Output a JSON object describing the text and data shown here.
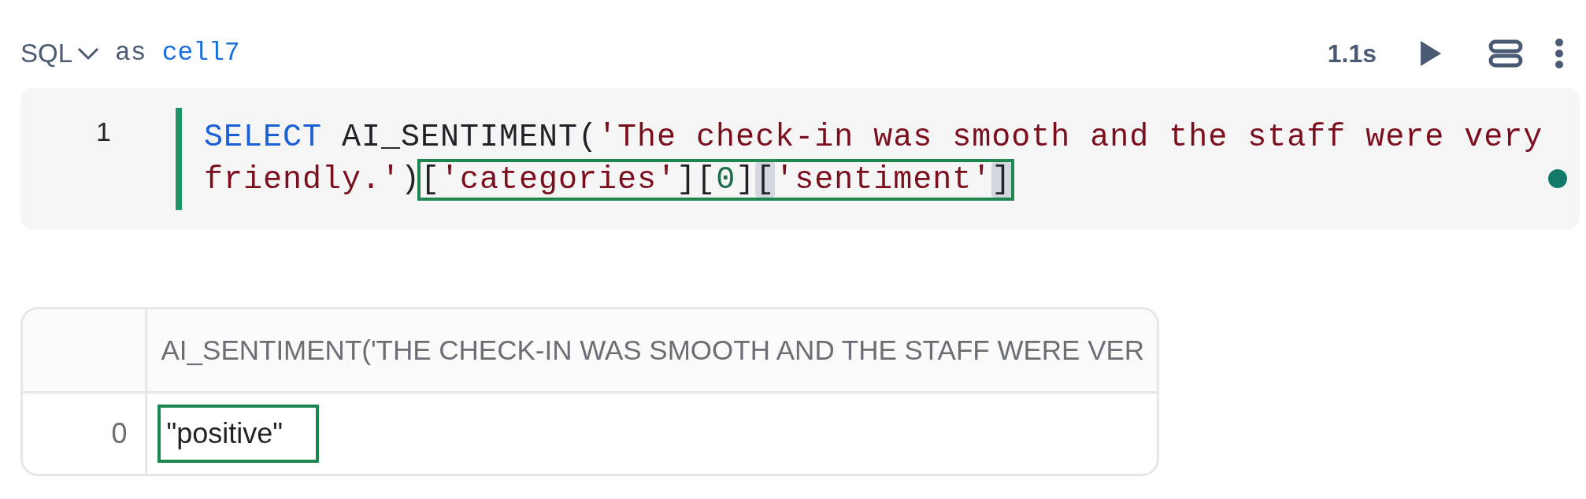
{
  "cell_header": {
    "language": "SQL",
    "as_label": "as",
    "cell_name": "cell7",
    "duration": "1.1s"
  },
  "code": {
    "line_number": "1",
    "rows": [
      [
        {
          "kind": "keyword",
          "text": "SELECT"
        },
        {
          "kind": "plain",
          "text": " AI_SENTIMENT("
        },
        {
          "kind": "string",
          "text": "'The check-in was smooth and the staff were very"
        }
      ],
      [
        {
          "kind": "string",
          "text": "friendly.'"
        },
        {
          "kind": "plain",
          "text": ")"
        },
        {
          "kind": "callout",
          "tokens": [
            {
              "kind": "plain",
              "text": "["
            },
            {
              "kind": "string",
              "text": "'categories'"
            },
            {
              "kind": "plain",
              "text": "]["
            },
            {
              "kind": "number",
              "text": "0"
            },
            {
              "kind": "plain",
              "text": "]"
            },
            {
              "kind": "bracket_match",
              "text": "["
            },
            {
              "kind": "string",
              "text": "'sentiment'"
            },
            {
              "kind": "bracket_match",
              "text": "]"
            }
          ]
        }
      ]
    ]
  },
  "result_table": {
    "columns": [
      "AI_SENTIMENT('THE CHECK-IN WAS SMOOTH AND THE STAFF WERE VER"
    ],
    "rows": [
      {
        "index": "0",
        "value": "\"positive\"",
        "outlined": true
      }
    ]
  }
}
